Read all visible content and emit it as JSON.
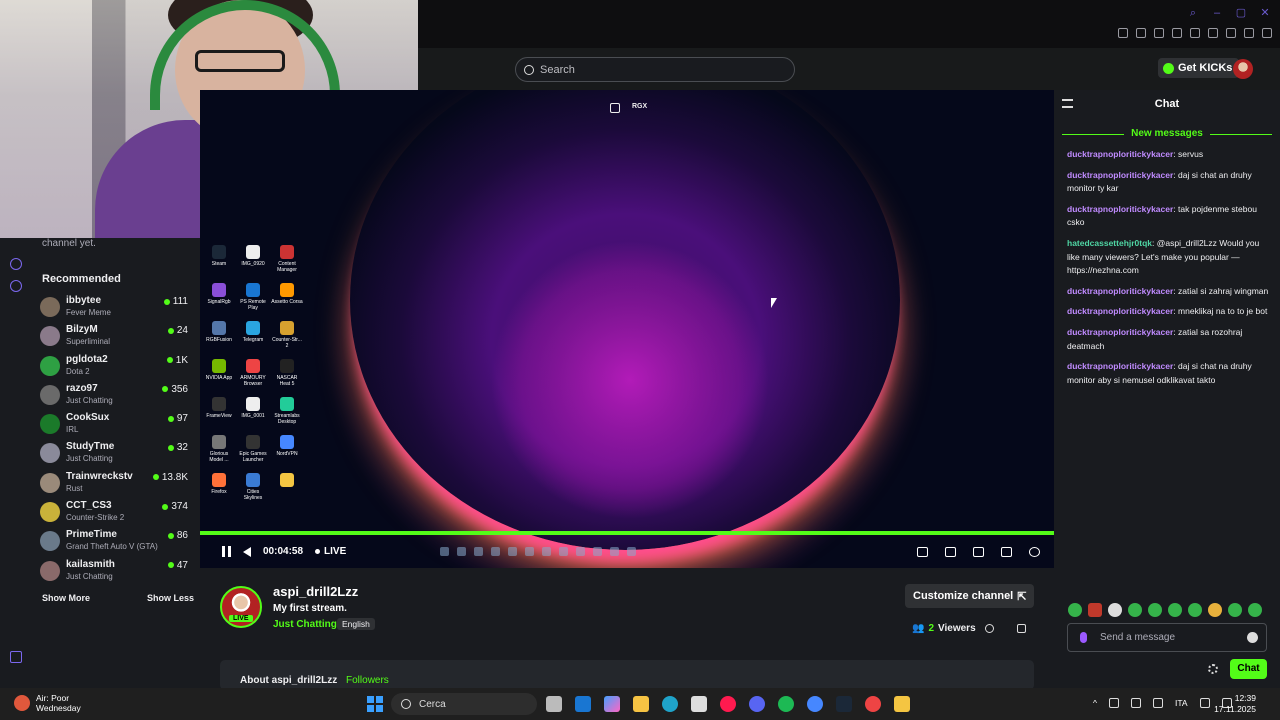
{
  "browser": {
    "window_controls": [
      "search",
      "minimize",
      "maximize",
      "close"
    ]
  },
  "header": {
    "search_placeholder": "Search",
    "get_kicks_label": "Get KICKs"
  },
  "sidebar": {
    "following_empty_text": "channel yet.",
    "recommended_title": "Recommended",
    "recommended": [
      {
        "name": "ibbytee",
        "category": "Fever Meme",
        "viewers": "111"
      },
      {
        "name": "BilzyM",
        "category": "Superliminal",
        "viewers": "24"
      },
      {
        "name": "pgldota2",
        "category": "Dota 2",
        "viewers": "1K"
      },
      {
        "name": "razo97",
        "category": "Just Chatting",
        "viewers": "356"
      },
      {
        "name": "CookSux",
        "category": "IRL",
        "viewers": "97"
      },
      {
        "name": "StudyTme",
        "category": "Just Chatting",
        "viewers": "32"
      },
      {
        "name": "Trainwreckstv",
        "category": "Rust",
        "viewers": "13.8K"
      },
      {
        "name": "CCT_CS3",
        "category": "Counter-Strike 2",
        "viewers": "374"
      },
      {
        "name": "PrimeTime",
        "category": "Grand Theft Auto V (GTA)",
        "viewers": "86"
      },
      {
        "name": "kailasmith",
        "category": "Just Chatting",
        "viewers": "47"
      }
    ],
    "show_more": "Show More",
    "show_less": "Show Less"
  },
  "player": {
    "overlay_label": "RGX",
    "elapsed": "00:04:58",
    "live_label": "LIVE",
    "progress_fraction": 1.0,
    "desktop_icons": [
      "Steam",
      "IMG_0920",
      "Content Manager",
      "SignalRgb",
      "PS Remote Play",
      "Assetto Corsa",
      "RGBFusion",
      "Telegram",
      "Counter-Str... 2",
      "NVIDIA App",
      "ARMOURY Browser",
      "NASCAR Heat 5",
      "FrameView",
      "IMG_0001",
      "Streamlabs Desktop",
      "Glorious Model ...",
      "Epic Games Launcher",
      "NordVPN",
      "Firefox",
      "Cities Skylines",
      ""
    ]
  },
  "channel": {
    "live_badge": "LIVE",
    "name": "aspi_drill2Lzz",
    "stream_title": "My first stream.",
    "category": "Just Chatting",
    "language": "English",
    "customize_label": "Customize channel",
    "viewers_count": "2",
    "viewers_label": "Viewers",
    "about_label": "About aspi_drill2Lzz",
    "followers_label": "Followers"
  },
  "chat": {
    "title": "Chat",
    "new_messages_label": "New messages",
    "messages": [
      {
        "user": "ducktrapnoploritickykacer",
        "text": "servus",
        "color": "#c08bff"
      },
      {
        "user": "ducktrapnoploritickykacer",
        "text": "daj si chat an druhy monitor ty kar",
        "color": "#c08bff"
      },
      {
        "user": "ducktrapnoploritickykacer",
        "text": "tak pojdenme stebou csko",
        "color": "#c08bff"
      },
      {
        "user": "hatedcassettehjr0tqk",
        "text": "@aspi_drill2Lzz Would you like many viewers? Let's make you popular — https://nezhna.com",
        "color": "#4fd6a4"
      },
      {
        "user": "ducktrapnoploritickykacer",
        "text": "zatial si zahraj wingman",
        "color": "#c08bff"
      },
      {
        "user": "ducktrapnoploritickykacer",
        "text": "mneklikaj na to to je bot",
        "color": "#c08bff"
      },
      {
        "user": "ducktrapnoploritickykacer",
        "text": "zatial sa rozohraj deatmach",
        "color": "#c08bff"
      },
      {
        "user": "ducktrapnoploritickykacer",
        "text": "daj si chat na druhy monitor aby si nemusel odklikavat takto",
        "color": "#c08bff"
      }
    ],
    "input_placeholder": "Send a message",
    "send_label": "Chat"
  },
  "taskbar": {
    "weather_line1": "Air: Poor",
    "weather_line2": "Wednesday",
    "search_placeholder": "Cerca",
    "language": "ITA",
    "time": "12:39",
    "date": "17.11.2025"
  },
  "colors": {
    "accent": "#53fc18",
    "background": "#191b1f"
  }
}
